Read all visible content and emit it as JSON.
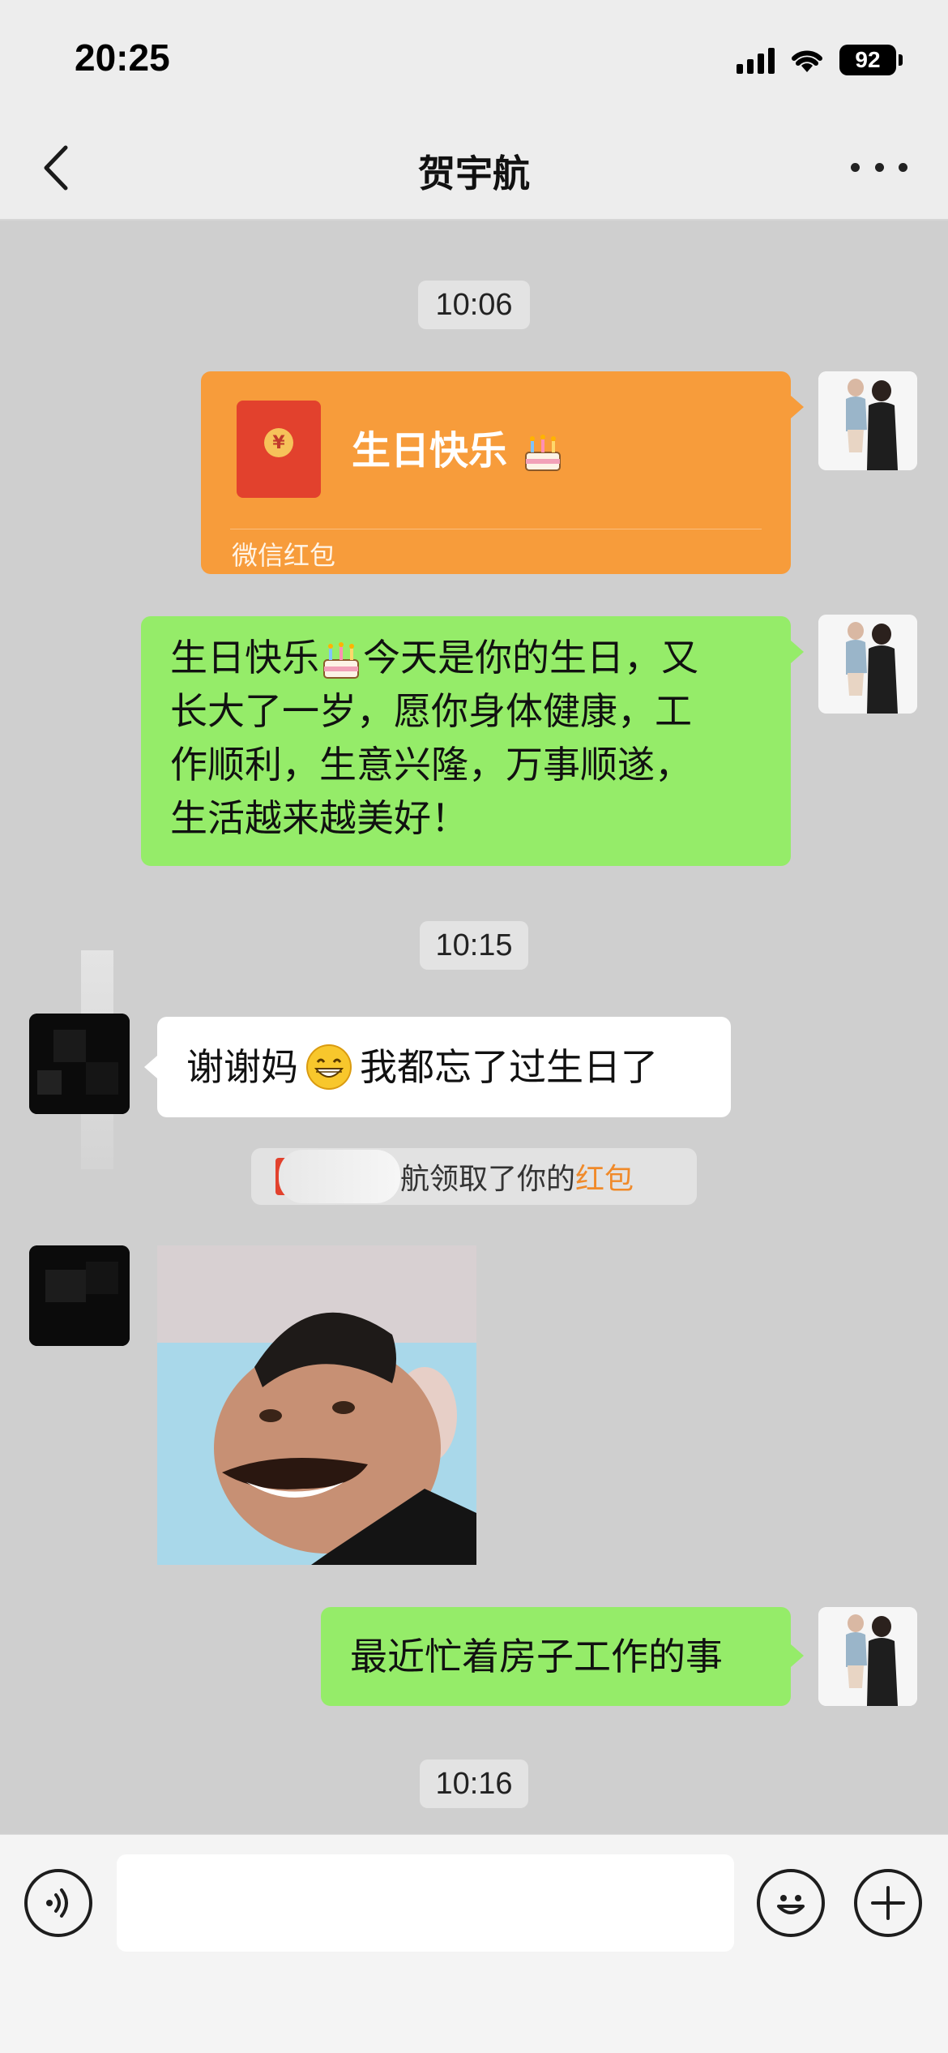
{
  "status_bar": {
    "time": "20:25",
    "battery": "92",
    "icons": [
      "signal-icon",
      "wifi-icon",
      "battery-icon"
    ]
  },
  "nav": {
    "title": "贺宇航",
    "back_icon": "chevron-left-icon",
    "more_icon": "more-dots-icon"
  },
  "messages": {
    "time_1": "10:06",
    "red_packet": {
      "title": "生日快乐",
      "footer": "微信红包",
      "emoji": "birthday-cake-emoji"
    },
    "greeting": {
      "line1_a": "生日快乐",
      "line1_b": "今天是你的生日，又",
      "line2": "长大了一岁，愿你身体健康，工",
      "line3": "作顺利，生意兴隆，万事顺遂，",
      "line4": "生活越来越美好！"
    },
    "time_2": "10:15",
    "reply": {
      "part1": "谢谢妈",
      "part2": "我都忘了过生日了",
      "emoji": "grinning-face-emoji"
    },
    "system": {
      "text": "航领取了你的",
      "link": "红包"
    },
    "sticker": {
      "name": "funny-face-sticker"
    },
    "busy": "最近忙着房子工作的事",
    "time_3": "10:16"
  },
  "input_bar": {
    "voice_icon": "voice-icon",
    "emoji_icon": "emoji-icon",
    "plus_icon": "plus-icon",
    "value": ""
  },
  "colors": {
    "chat_background": "#cfcfcf",
    "sent_bubble": "#95ec69",
    "received_bubble": "#ffffff",
    "red_packet": "#f79c3b",
    "link": "#f08a2a"
  }
}
